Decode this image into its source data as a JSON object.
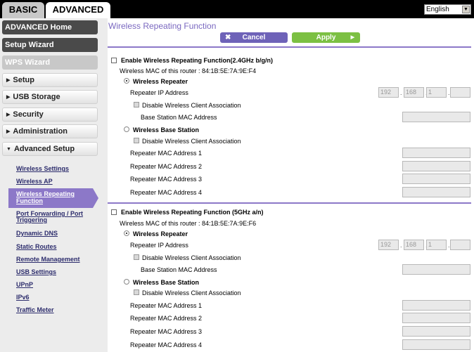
{
  "tabs": {
    "basic": "BASIC",
    "advanced": "ADVANCED"
  },
  "language": {
    "value": "English"
  },
  "sidebar": {
    "advanced_home": "ADVANCED Home",
    "setup_wizard": "Setup Wizard",
    "wps_wizard": "WPS Wizard",
    "setup": "Setup",
    "usb_storage": "USB Storage",
    "security": "Security",
    "administration": "Administration",
    "advanced_setup": "Advanced Setup",
    "sub": {
      "wireless_settings": "Wireless Settings",
      "wireless_ap": "Wireless AP",
      "wireless_repeating_1": "Wireless Repeating",
      "wireless_repeating_2": "Function",
      "port_forwarding_1": "Port Forwarding / Port",
      "port_forwarding_2": "Triggering",
      "dynamic_dns": "Dynamic DNS",
      "static_routes": "Static Routes",
      "remote_management": "Remote Management",
      "usb_settings": "USB Settings",
      "upnp": "UPnP",
      "ipv6": "IPv6",
      "traffic_meter": "Traffic Meter"
    }
  },
  "main": {
    "title": "Wireless Repeating Function",
    "cancel": "Cancel",
    "apply": "Apply",
    "band24": {
      "enable": "Enable Wireless Repeating Function(2.4GHz b/g/n)",
      "mac": "Wireless MAC of this router : 84:1B:5E:7A:9E:F4",
      "repeater": "Wireless Repeater",
      "repeater_ip": "Repeater IP Address",
      "ip": [
        "192",
        "168",
        "1",
        ""
      ],
      "disable_assoc_1": "Disable Wireless Client Association",
      "base_mac": "Base Station MAC Address",
      "base_station": "Wireless Base Station",
      "disable_assoc_2": "Disable Wireless Client Association",
      "rep_mac_1": "Repeater MAC Address 1",
      "rep_mac_2": "Repeater MAC Address 2",
      "rep_mac_3": "Repeater MAC Address 3",
      "rep_mac_4": "Repeater MAC Address 4"
    },
    "band5": {
      "enable": "Enable Wireless Repeating Function (5GHz a/n)",
      "mac": "Wireless MAC of this router : 84:1B:5E:7A:9E:F6",
      "repeater": "Wireless Repeater",
      "repeater_ip": "Repeater IP Address",
      "ip": [
        "192",
        "168",
        "1",
        ""
      ],
      "disable_assoc_1": "Disable Wireless Client Association",
      "base_mac": "Base Station MAC Address",
      "base_station": "Wireless Base Station",
      "disable_assoc_2": "Disable Wireless Client Association",
      "rep_mac_1": "Repeater MAC Address 1",
      "rep_mac_2": "Repeater MAC Address 2",
      "rep_mac_3": "Repeater MAC Address 3",
      "rep_mac_4": "Repeater MAC Address 4"
    }
  }
}
